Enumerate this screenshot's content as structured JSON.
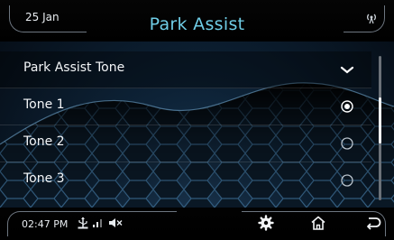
{
  "header": {
    "date": "25 Jan",
    "title": "Park Assist",
    "title_color": "#6fcde6",
    "status_icon": "wireless-signal-icon"
  },
  "menu": {
    "section_label": "Park Assist Tone",
    "section_state": "expanded",
    "section_icon": "chevron-down-icon",
    "items": [
      {
        "label": "Tone 1",
        "selected": true
      },
      {
        "label": "Tone 2",
        "selected": false
      },
      {
        "label": "Tone 3",
        "selected": false
      }
    ]
  },
  "scroll": {
    "position": 0.42,
    "visible_fraction": 0.32
  },
  "status_bar": {
    "time": "02:47 PM",
    "icons": [
      "usb-icon",
      "signal-strength-icon",
      "mute-icon"
    ]
  },
  "bottom_nav": [
    {
      "icon": "settings-gear-icon"
    },
    {
      "icon": "home-icon"
    },
    {
      "icon": "back-arrow-icon"
    }
  ]
}
